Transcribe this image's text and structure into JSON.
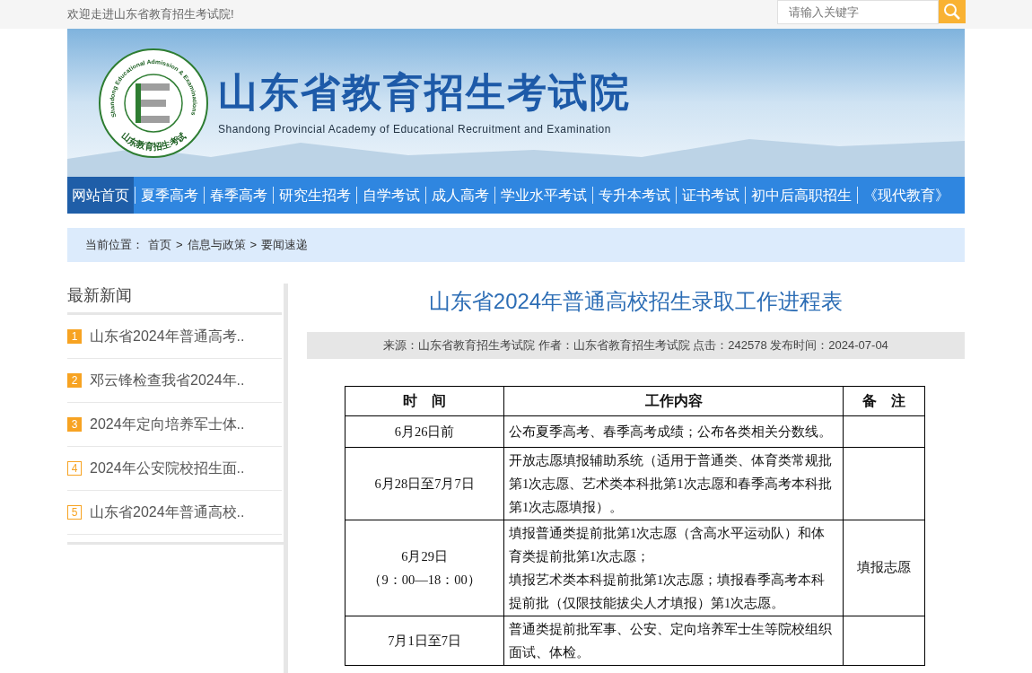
{
  "top_bar": {
    "welcome": "欢迎走进山东省教育招生考试院!",
    "search": {
      "placeholder": "请输入关键字"
    }
  },
  "banner": {
    "title": "山东省教育招生考试院",
    "subtitle": "Shandong Provincial Academy of Educational Recruitment and Examination",
    "logo": {
      "ring_text": "Shandong Educational Admission & Examinations",
      "ring_text_cn": "山东教育招生考试"
    }
  },
  "nav": [
    {
      "label": "网站首页",
      "selected": true
    },
    {
      "label": "夏季高考",
      "selected": false
    },
    {
      "label": "春季高考",
      "selected": false
    },
    {
      "label": "研究生招考",
      "selected": false
    },
    {
      "label": "自学考试",
      "selected": false
    },
    {
      "label": "成人高考",
      "selected": false
    },
    {
      "label": "学业水平考试",
      "selected": false
    },
    {
      "label": "专升本考试",
      "selected": false
    },
    {
      "label": "证书考试",
      "selected": false
    },
    {
      "label": "初中后高职招生",
      "selected": false
    },
    {
      "label": "《现代教育》",
      "selected": false
    }
  ],
  "breadcrumb": {
    "label": "当前位置：",
    "items": [
      "首页",
      "信息与政策",
      "要闻速递"
    ],
    "separator": ">"
  },
  "sidebar": {
    "title": "最新新闻",
    "items": [
      {
        "number": "1",
        "highlighted": true,
        "title": "山东省2024年普通高考.."
      },
      {
        "number": "2",
        "highlighted": true,
        "title": "邓云锋检查我省2024年.."
      },
      {
        "number": "3",
        "highlighted": true,
        "title": "2024年定向培养军士体.."
      },
      {
        "number": "4",
        "highlighted": false,
        "title": "2024年公安院校招生面.."
      },
      {
        "number": "5",
        "highlighted": false,
        "title": "山东省2024年普通高校.."
      }
    ]
  },
  "article": {
    "title": "山东省2024年普通高校招生录取工作进程表",
    "meta": "来源：山东省教育招生考试院 作者：山东省教育招生考试院 点击：242578 发布时间：2024-07-04",
    "table": {
      "columns": [
        "时　间",
        "工作内容",
        "备　注"
      ],
      "rows": [
        {
          "time": [
            "6月26日前"
          ],
          "content": [
            "公布夏季高考、春季高考成绩；公布各类相关分数线。"
          ],
          "note": ""
        },
        {
          "time": [
            "6月28日至7月7日"
          ],
          "content": [
            "开放志愿填报辅助系统（适用于普通类、体育类常规批第1次志愿、艺术类本科批第1次志愿和春季高考本科批第1次志愿填报）。"
          ],
          "note": ""
        },
        {
          "time": [
            "6月29日",
            "（9：00—18：00）"
          ],
          "content": [
            "填报普通类提前批第1次志愿（含高水平运动队）和体育类提前批第1次志愿；",
            "填报艺术类本科提前批第1次志愿；填报春季高考本科提前批（仅限技能拔尖人才填报）第1次志愿。"
          ],
          "note": "填报志愿"
        },
        {
          "time": [
            "7月1日至7日"
          ],
          "content": [
            "普通类提前批军事、公安、定向培养军士生等院校组织面试、体检。"
          ],
          "note": ""
        }
      ]
    }
  }
}
